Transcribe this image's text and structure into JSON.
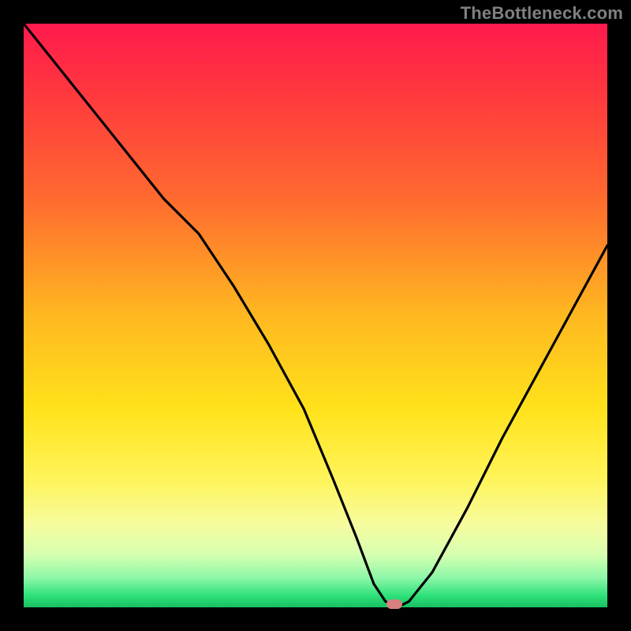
{
  "attribution": "TheBottleneck.com",
  "chart_data": {
    "type": "line",
    "title": "",
    "xlabel": "",
    "ylabel": "",
    "xlim": [
      0,
      100
    ],
    "ylim": [
      0,
      100
    ],
    "x": [
      0,
      8,
      16,
      24,
      30,
      36,
      42,
      48,
      53,
      57,
      60,
      62,
      64,
      66,
      70,
      76,
      82,
      88,
      94,
      100
    ],
    "values": [
      100,
      90,
      80,
      70,
      64,
      55,
      45,
      34,
      22,
      12,
      4,
      1,
      0,
      1,
      6,
      17,
      29,
      40,
      51,
      62
    ],
    "marker": {
      "x": 63.5,
      "y": 0.5,
      "color": "#d88080"
    },
    "background_gradient": {
      "direction": "vertical",
      "stops": [
        {
          "pos": 0.0,
          "color": "#ff1a4d"
        },
        {
          "pos": 0.3,
          "color": "#ff6a2f"
        },
        {
          "pos": 0.66,
          "color": "#ffe21a"
        },
        {
          "pos": 0.9,
          "color": "#d6ffb0"
        },
        {
          "pos": 1.0,
          "color": "#18c060"
        }
      ]
    }
  }
}
